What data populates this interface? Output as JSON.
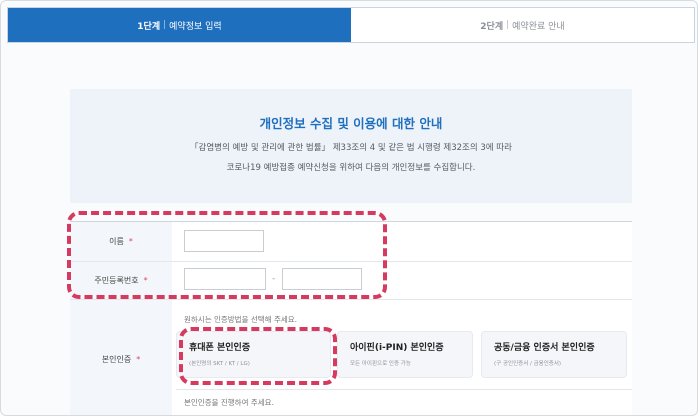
{
  "steps": [
    {
      "num": "1단계",
      "label": "예약정보 입력"
    },
    {
      "num": "2단계",
      "label": "예약완료 안내"
    }
  ],
  "notice": {
    "title": "개인정보 수집 및 이용에 대한 안내",
    "line1": "「감염병의 예방 및 관리에 관한 법률」 제33조의 4 및 같은 법 시행령 제32조의 3에 따라",
    "line2": "코로나19 예방접종 예약신청을 위하여 다음의 개인정보를 수집합니다."
  },
  "form": {
    "required_mark": "*",
    "name_label": "이름",
    "rrn_label": "주민등록번호",
    "rrn_dash": "-",
    "auth_label": "본인인증",
    "auth_hint": "원하시는 인증방법을 선택해 주세요.",
    "auth_footer": "본인인증을 진행하여 주세요."
  },
  "auth_options": [
    {
      "title": "휴대폰 본인인증",
      "sub": "(본인명의 SKT / KT / LG)"
    },
    {
      "title": "아이핀(i-PIN) 본인인증",
      "sub": "모든 아이핀으로 인증 가능"
    },
    {
      "title": "공동/금융 인증서 본인인증",
      "sub": "(구 공인인증서 / 금융인증서)"
    }
  ],
  "colors": {
    "accent": "#1f6fbf",
    "highlight": "#d63a5e",
    "required": "#e0455a"
  }
}
